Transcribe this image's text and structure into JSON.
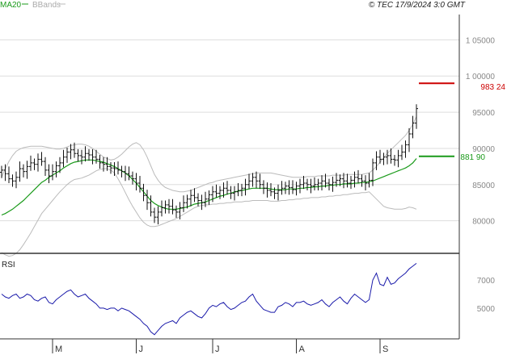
{
  "header": {
    "legend_ma": "MA20",
    "legend_bb": "BBands",
    "copyright": "© TEC 17/9/2024 3:0 GMT"
  },
  "colors": {
    "ma": "#1a9a1a",
    "bands": "#bbbbbb",
    "price": "#111111",
    "rsi": "#1a1aaa",
    "last_price": "#cc0000",
    "grid": "#dddddd",
    "frame": "#333333"
  },
  "chart_data": [
    {
      "type": "line",
      "variant": "ohlc-bars",
      "y_ticks": [
        {
          "value": 1050,
          "label": "1 05000"
        },
        {
          "value": 1000,
          "label": "1 00000"
        },
        {
          "value": 950,
          "label": "95000"
        },
        {
          "value": 900,
          "label": "90000"
        },
        {
          "value": 850,
          "label": "85000"
        },
        {
          "value": 800,
          "label": "80000"
        }
      ],
      "ylim": [
        755,
        1085
      ],
      "grid": true,
      "months": [
        {
          "label": "M",
          "index": 14
        },
        {
          "label": "J",
          "index": 37
        },
        {
          "label": "J",
          "index": 58
        },
        {
          "label": "A",
          "index": 81
        },
        {
          "label": "S",
          "index": 104
        }
      ],
      "n_bars": 115,
      "close": [
        870,
        865,
        858,
        855,
        860,
        872,
        868,
        875,
        880,
        878,
        885,
        882,
        870,
        862,
        868,
        876,
        880,
        888,
        895,
        898,
        893,
        890,
        888,
        893,
        891,
        888,
        885,
        880,
        878,
        875,
        873,
        872,
        870,
        868,
        865,
        862,
        858,
        852,
        845,
        835,
        825,
        812,
        805,
        812,
        818,
        822,
        820,
        815,
        812,
        818,
        825,
        830,
        835,
        832,
        828,
        825,
        830,
        836,
        840,
        838,
        842,
        845,
        842,
        838,
        840,
        842,
        845,
        850,
        855,
        860,
        855,
        850,
        845,
        842,
        840,
        838,
        842,
        845,
        848,
        846,
        843,
        848,
        850,
        852,
        850,
        848,
        850,
        852,
        855,
        852,
        850,
        853,
        856,
        858,
        855,
        852,
        856,
        860,
        858,
        855,
        852,
        856,
        880,
        888,
        885,
        888,
        890,
        885,
        884,
        890,
        895,
        905,
        920,
        935,
        955
      ],
      "ma20": [
        808,
        810,
        813,
        816,
        820,
        824,
        828,
        833,
        838,
        843,
        848,
        853,
        856,
        860,
        863,
        866,
        869,
        873,
        876,
        879,
        881,
        882,
        883,
        884,
        884,
        884,
        883,
        882,
        881,
        879,
        877,
        875,
        872,
        869,
        866,
        862,
        857,
        852,
        846,
        840,
        834,
        828,
        824,
        821,
        819,
        817,
        816,
        816,
        816,
        817,
        818,
        819,
        821,
        823,
        824,
        825,
        826,
        828,
        830,
        832,
        834,
        835,
        837,
        838,
        840,
        841,
        842,
        843,
        844,
        845,
        845,
        845,
        845,
        845,
        844,
        843,
        843,
        843,
        843,
        844,
        844,
        844,
        845,
        845,
        846,
        846,
        847,
        847,
        848,
        848,
        849,
        849,
        850,
        850,
        851,
        851,
        851,
        852,
        852,
        853,
        853,
        854,
        855,
        857,
        859,
        861,
        863,
        865,
        867,
        869,
        871,
        873,
        876,
        880,
        886
      ],
      "bb_upper": [
        860,
        872,
        882,
        890,
        896,
        899,
        901,
        902,
        903,
        903,
        903,
        903,
        902,
        901,
        900,
        899,
        899,
        900,
        902,
        904,
        905,
        906,
        906,
        905,
        903,
        900,
        896,
        892,
        888,
        886,
        884,
        885,
        888,
        892,
        897,
        902,
        906,
        908,
        905,
        898,
        888,
        876,
        864,
        856,
        850,
        846,
        844,
        842,
        841,
        840,
        840,
        841,
        842,
        844,
        846,
        848,
        850,
        852,
        853,
        855,
        856,
        857,
        858,
        859,
        860,
        861,
        862,
        863,
        864,
        865,
        866,
        866,
        866,
        866,
        866,
        865,
        864,
        863,
        862,
        861,
        860,
        860,
        860,
        860,
        861,
        861,
        861,
        862,
        862,
        862,
        862,
        863,
        863,
        863,
        863,
        864,
        864,
        864,
        864,
        864,
        865,
        866,
        870,
        875,
        881,
        887,
        893,
        898,
        903,
        908,
        913,
        918,
        925,
        933,
        944
      ],
      "bb_lower": [
        756,
        753,
        751,
        752,
        755,
        760,
        767,
        775,
        783,
        792,
        801,
        810,
        816,
        822,
        828,
        834,
        840,
        845,
        850,
        854,
        857,
        858,
        859,
        861,
        863,
        866,
        869,
        871,
        872,
        872,
        870,
        866,
        858,
        849,
        839,
        829,
        820,
        812,
        804,
        798,
        794,
        792,
        792,
        793,
        795,
        797,
        799,
        801,
        803,
        806,
        809,
        812,
        815,
        818,
        820,
        821,
        822,
        822,
        823,
        823,
        824,
        824,
        825,
        825,
        826,
        826,
        826,
        827,
        827,
        828,
        828,
        828,
        828,
        828,
        827,
        827,
        827,
        828,
        828,
        829,
        829,
        830,
        830,
        831,
        831,
        832,
        832,
        832,
        833,
        833,
        834,
        834,
        835,
        835,
        836,
        836,
        837,
        838,
        838,
        839,
        839,
        840,
        835,
        830,
        825,
        820,
        818,
        817,
        816,
        816,
        816,
        817,
        819,
        818,
        816
      ],
      "last_price": {
        "label": "983 24",
        "value": 990
      },
      "last_ma": {
        "label": "881 90",
        "value": 889
      }
    },
    {
      "type": "line",
      "title": "RSI",
      "y_ticks": [
        {
          "value": 70,
          "label": "7000"
        },
        {
          "value": 50,
          "label": "5000"
        }
      ],
      "ylim": [
        28,
        88
      ],
      "values": [
        60,
        58,
        57,
        59,
        60,
        57,
        58,
        60,
        59,
        56,
        55,
        57,
        58,
        54,
        53,
        56,
        58,
        60,
        62,
        63,
        60,
        58,
        59,
        60,
        57,
        55,
        53,
        50,
        50,
        49,
        50,
        50,
        48,
        50,
        49,
        48,
        46,
        44,
        42,
        39,
        37,
        33,
        31,
        34,
        37,
        39,
        40,
        41,
        39,
        43,
        45,
        47,
        48,
        46,
        44,
        43,
        46,
        50,
        52,
        51,
        53,
        54,
        51,
        49,
        50,
        52,
        54,
        55,
        58,
        60,
        55,
        52,
        49,
        48,
        47,
        47,
        51,
        52,
        54,
        53,
        51,
        54,
        54,
        55,
        53,
        52,
        53,
        54,
        56,
        53,
        51,
        54,
        56,
        58,
        55,
        53,
        57,
        60,
        58,
        56,
        54,
        56,
        70,
        75,
        67,
        66,
        72,
        67,
        68,
        71,
        73,
        75,
        78,
        80,
        82
      ]
    }
  ]
}
